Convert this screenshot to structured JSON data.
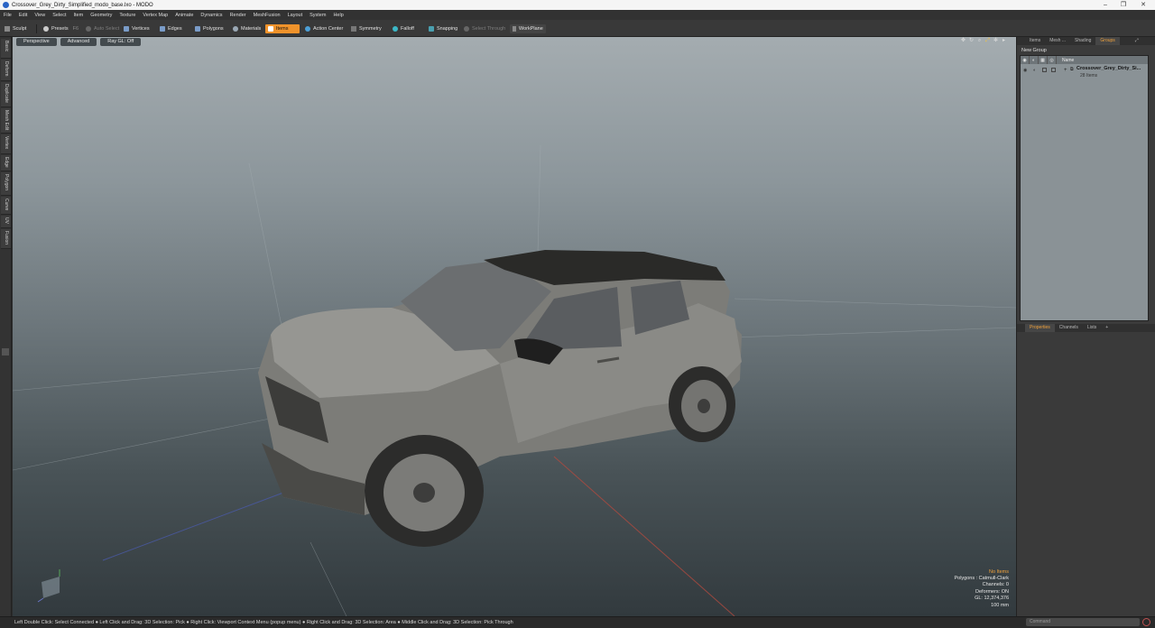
{
  "window": {
    "title": "Crossover_Grey_Dirty_Simplified_modo_base.lxo - MODO"
  },
  "menu": [
    "File",
    "Edit",
    "View",
    "Select",
    "Item",
    "Geometry",
    "Texture",
    "Vertex Map",
    "Animate",
    "Dynamics",
    "Render",
    "MeshFusion",
    "Layout",
    "System",
    "Help"
  ],
  "toolbar": {
    "sculpt": "Sculpt",
    "presets": "Presets",
    "presets_key": "F6",
    "auto_select": "Auto Select",
    "vertices": "Vertices",
    "edges": "Edges",
    "polygons": "Polygons",
    "materials": "Materials",
    "items": "Items",
    "action_center": "Action Center",
    "symmetry": "Symmetry",
    "falloff": "Falloff",
    "snapping": "Snapping",
    "select_through": "Select Through",
    "workplane": "WorkPlane"
  },
  "left_tabs": [
    "Basic",
    "Deform",
    "Duplicate",
    "Mesh Edit",
    "Vertex",
    "Edge",
    "Polygon",
    "Curve",
    "UV",
    "Fusion"
  ],
  "viewport": {
    "view": "Perspective",
    "mode": "Advanced",
    "ray_gl": "Ray GL: Off"
  },
  "info": {
    "no_items": "No Items",
    "polygons": "Polygons : Catmull-Clark",
    "channels": "Channels: 0",
    "deformers": "Deformers: ON",
    "gl": "GL: 12,374,376",
    "distance": "100 mm"
  },
  "right_panel": {
    "tabs": [
      "Items",
      "Mesh ...",
      "Shading",
      "Groups"
    ],
    "active_tab": "Groups",
    "new_group": "New Group",
    "name_header": "Name",
    "group_name": "Crossover_Grey_Dirty_Si...",
    "group_count": "28 Items",
    "lower_tabs": [
      "Properties",
      "Channels",
      "Lists"
    ],
    "lower_active": "Properties"
  },
  "status": "Left Double Click: Select Connected ● Left Click and Drag: 3D Selection: Pick ● Right Click: Viewport Context Menu (popup menu) ● Right Click and Drag: 3D Selection: Area ● Middle Click and Drag: 3D Selection: Pick Through",
  "command_placeholder": "Command",
  "colors": {
    "accent": "#f0932b",
    "panel": "#3b3b3b",
    "viewport_top": "#a4acb0",
    "viewport_bottom": "#323a3e"
  }
}
